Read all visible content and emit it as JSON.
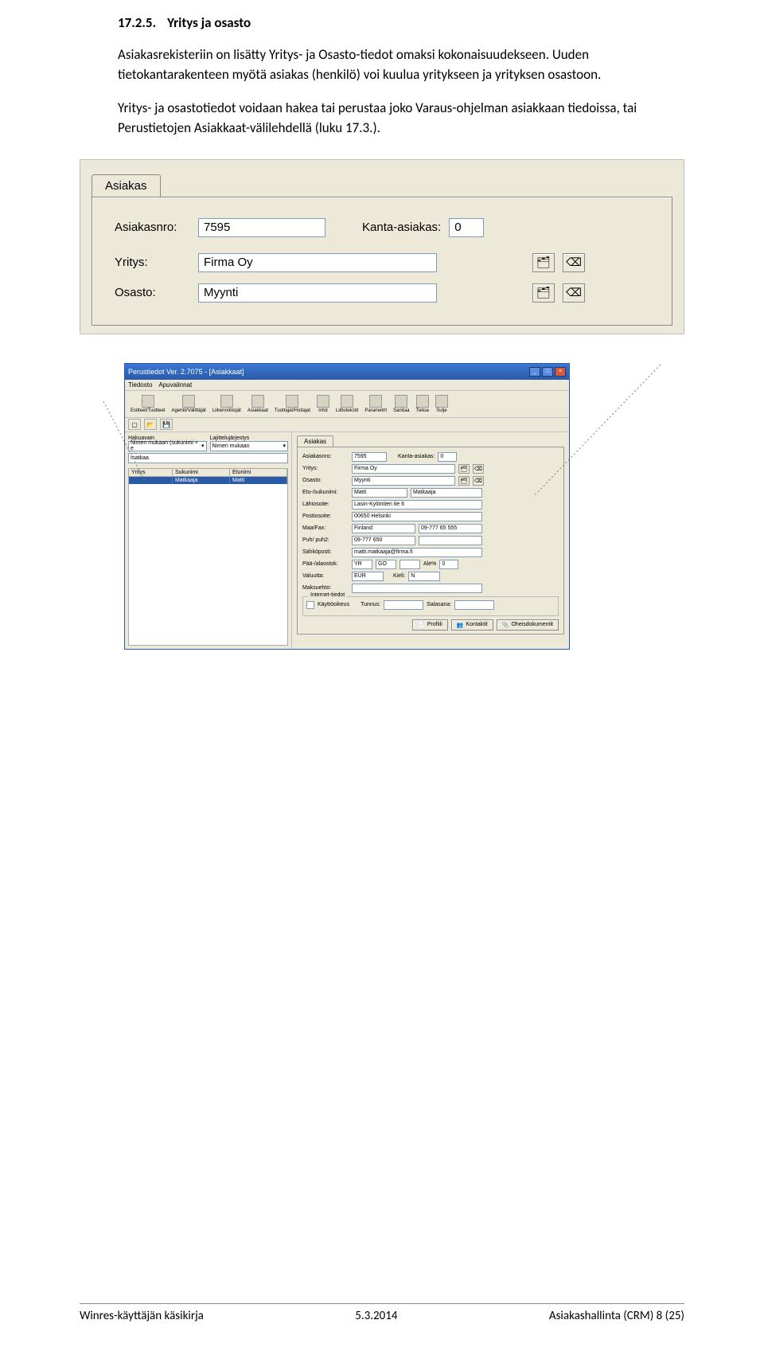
{
  "heading": {
    "number": "17.2.5.",
    "title": "Yritys ja osasto"
  },
  "para1": "Asiakasrekisteriin on lisätty Yritys- ja Osasto-tiedot omaksi kokonaisuudekseen. Uuden tietokantarakenteen myötä asiakas (henkilö) voi kuulua yritykseen ja yrityksen osastoon.",
  "para2": "Yritys- ja osastotiedot voidaan hakea tai perustaa joko Varaus-ohjelman asiakkaan tiedoissa, tai Perustietojen Asiakkaat-välilehdellä (luku 17.3.).",
  "shot1": {
    "tab": "Asiakas",
    "asiakasnro_label": "Asiakasnro:",
    "asiakasnro_value": "7595",
    "kanta_label": "Kanta-asiakas:",
    "kanta_value": "0",
    "yritys_label": "Yritys:",
    "yritys_value": "Firma Oy",
    "osasto_label": "Osasto:",
    "osasto_value": "Myynti"
  },
  "shot2": {
    "title": "Perustiedot Ver. 2.7075 - [Asiakkaat]",
    "menu": [
      "Tiedosto",
      "Apuvalinnat"
    ],
    "toolbar": [
      "Esitteet/Tuotteet",
      "Agentit/Välittäjät",
      "Liikennöitsijät",
      "Asiakkaat",
      "Tuottajat/Hoitajat",
      "Infot",
      "Liittotekstit",
      "Parametrit",
      "Sanitaa",
      "Tietoa",
      "Sulje"
    ],
    "left": {
      "hakuavain": "Hakuavain",
      "lajittelu": "Lajittelujärjestys",
      "d1": "Nimen mukaan (sukunimi + e",
      "d2": "Nimen mukaan",
      "search": "matkaa",
      "cols": [
        "Yritys",
        "Sukunimi",
        "Etunimi"
      ],
      "row": [
        "",
        "Matkaaja",
        "Matti"
      ]
    },
    "right": {
      "tab": "Asiakas",
      "asiakasnro_l": "Asiakasnro:",
      "asiakasnro_v": "7595",
      "kanta_l": "Kanta-asiakas:",
      "kanta_v": "0",
      "yritys_l": "Yritys:",
      "yritys_v": "Firma Oy",
      "osasto_l": "Osasto:",
      "osasto_v": "Myynti",
      "etusuku_l": "Etu-/sukunimi:",
      "etu_v": "Matti",
      "suku_v": "Matkaaja",
      "lahi_l": "Lähiosoite:",
      "lahi_v": "Lasin-Kylöntien tie 6",
      "posti_l": "Postiosoite:",
      "posti_v": "00650 Helsinki",
      "maa_l": "Maa/Fax:",
      "maa_v": "Finland",
      "fax_v": "09-777 65 555",
      "puh_l": "Puh/ puh2:",
      "puh_v": "09-777 650",
      "puh2_v": "",
      "email_l": "Sähköposti:",
      "email_v": "matti.matkaaja@firma.fi",
      "paa_l": "Pää-/alaostok:",
      "paa_v": "YR",
      "go": "GO",
      "ale_l": "Ale%",
      "ale_v": "0",
      "val_l": "Valuutta:",
      "val_v": "EUR",
      "kieli_l": "Kieli:",
      "kieli_v": "N",
      "maksu_l": "Maksuehto:",
      "group_title": "Internet-tiedot",
      "kaytto_l": "Käyttöoikeus",
      "tunnus_l": "Tunnus:",
      "salasana_l": "Salasana:",
      "btn_profiili": "Profiili",
      "btn_kontaktit": "Kontaktit",
      "btn_oheis": "Oheisdokumentit"
    }
  },
  "footer": {
    "left": "Winres-käyttäjän käsikirja",
    "center": "5.3.2014",
    "right": "Asiakashallinta (CRM)  8 (25)"
  }
}
